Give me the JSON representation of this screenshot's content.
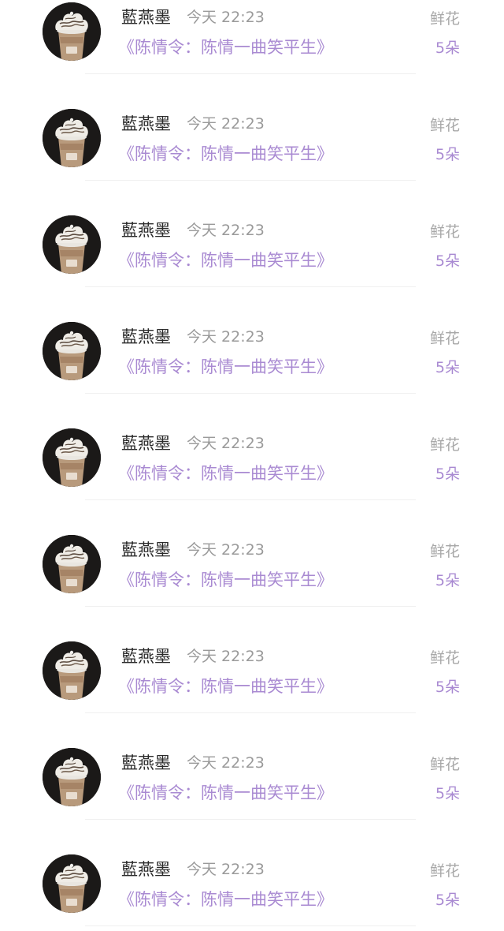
{
  "records": [
    {
      "user": "藍燕墨",
      "time": "今天 22:23",
      "work": "《陈情令：陈情一曲笑平生》",
      "gift": "鲜花",
      "count": "5朵"
    },
    {
      "user": "藍燕墨",
      "time": "今天 22:23",
      "work": "《陈情令：陈情一曲笑平生》",
      "gift": "鲜花",
      "count": "5朵"
    },
    {
      "user": "藍燕墨",
      "time": "今天 22:23",
      "work": "《陈情令：陈情一曲笑平生》",
      "gift": "鲜花",
      "count": "5朵"
    },
    {
      "user": "藍燕墨",
      "time": "今天 22:23",
      "work": "《陈情令：陈情一曲笑平生》",
      "gift": "鲜花",
      "count": "5朵"
    },
    {
      "user": "藍燕墨",
      "time": "今天 22:23",
      "work": "《陈情令：陈情一曲笑平生》",
      "gift": "鲜花",
      "count": "5朵"
    },
    {
      "user": "藍燕墨",
      "time": "今天 22:23",
      "work": "《陈情令：陈情一曲笑平生》",
      "gift": "鲜花",
      "count": "5朵"
    },
    {
      "user": "藍燕墨",
      "time": "今天 22:23",
      "work": "《陈情令：陈情一曲笑平生》",
      "gift": "鲜花",
      "count": "5朵"
    },
    {
      "user": "藍燕墨",
      "time": "今天 22:23",
      "work": "《陈情令：陈情一曲笑平生》",
      "gift": "鲜花",
      "count": "5朵"
    },
    {
      "user": "藍燕墨",
      "time": "今天 22:23",
      "work": "《陈情令：陈情一曲笑平生》",
      "gift": "鲜花",
      "count": "5朵"
    }
  ],
  "avatar_icon": "frappuccino-cup-icon"
}
